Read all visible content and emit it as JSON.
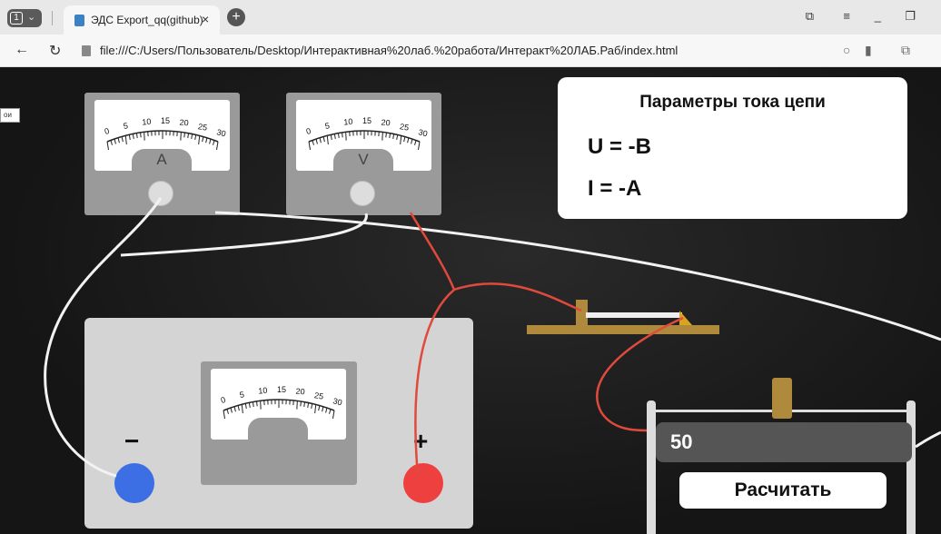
{
  "browser": {
    "tab_count": "1",
    "tab_title": "ЭДС Export_qq(github)",
    "url": "file:///C:/Users/Пользователь/Desktop/Интерактивная%20лаб.%20работа/Интеракт%20ЛАБ.Раб/index.html"
  },
  "page": {
    "side_tag": "ои",
    "ammeter": {
      "unit_label": "A",
      "scale": [
        "0",
        "5",
        "10",
        "15",
        "20",
        "25",
        "30"
      ]
    },
    "voltmeter": {
      "unit_label": "V",
      "scale": [
        "0",
        "5",
        "10",
        "15",
        "20",
        "25",
        "30"
      ]
    },
    "source_meter": {
      "scale": [
        "0",
        "5",
        "10",
        "15",
        "20",
        "25",
        "30"
      ]
    },
    "params": {
      "title": "Параметры тока цепи",
      "voltage_line": "U = -В",
      "current_line": "I = -А"
    },
    "power_supply": {
      "minus_sign": "−",
      "plus_sign": "+"
    },
    "rheostat": {
      "value": "50",
      "calc_button": "Расчитать"
    }
  },
  "colors": {
    "negative_terminal": "#3b6fe3",
    "positive_terminal": "#ef4040",
    "red_wire": "#e04a3c",
    "white_wire": "#f2f2f2",
    "slider_wood": "#b08a3c"
  }
}
